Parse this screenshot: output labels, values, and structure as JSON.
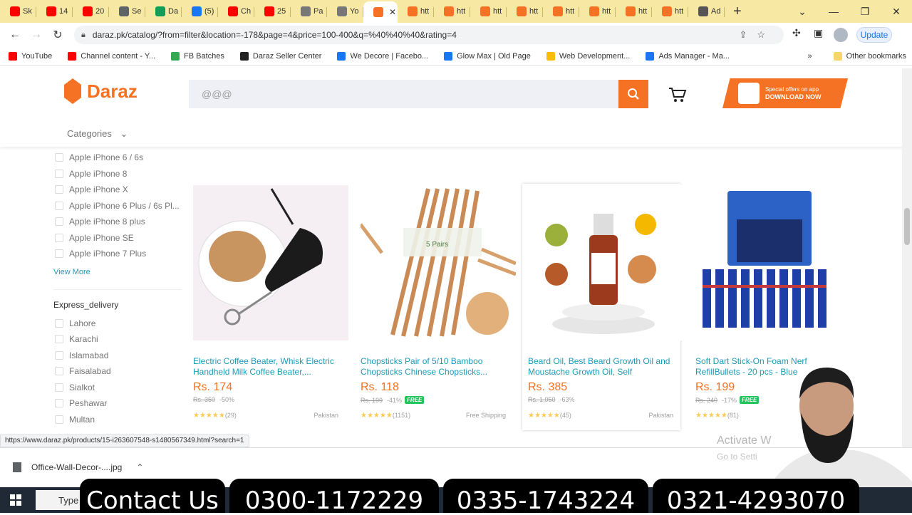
{
  "browser": {
    "tabs": [
      {
        "label": "Sk",
        "color": "#ff0000"
      },
      {
        "label": "14",
        "color": "#ff0000"
      },
      {
        "label": "20",
        "color": "#ff0000"
      },
      {
        "label": "Se",
        "color": "#5f6368"
      },
      {
        "label": "Da",
        "color": "#0f9d58"
      },
      {
        "label": "(5)",
        "color": "#1877f2"
      },
      {
        "label": "Ch",
        "color": "#ff0000"
      },
      {
        "label": "25",
        "color": "#ff0000"
      },
      {
        "label": "Pa",
        "color": "#777777"
      },
      {
        "label": "Yo",
        "color": "#777777"
      },
      {
        "label": "",
        "color": "#f57224"
      },
      {
        "label": "htt",
        "color": "#f57224"
      },
      {
        "label": "htt",
        "color": "#f57224"
      },
      {
        "label": "htt",
        "color": "#f57224"
      },
      {
        "label": "htt",
        "color": "#f57224"
      },
      {
        "label": "htt",
        "color": "#f57224"
      },
      {
        "label": "htt",
        "color": "#f57224"
      },
      {
        "label": "htt",
        "color": "#f57224"
      },
      {
        "label": "htt",
        "color": "#f57224"
      },
      {
        "label": "Ad",
        "color": "#555555"
      }
    ],
    "url": "daraz.pk/catalog/?from=filter&location=-178&page=4&price=100-400&q=%40%40%40&rating=4",
    "update_label": "Update",
    "bookmarks": [
      {
        "label": "YouTube",
        "color": "#ff0000"
      },
      {
        "label": "Channel content - Y...",
        "color": "#ff0000"
      },
      {
        "label": "FB Batches",
        "color": "#34a853"
      },
      {
        "label": "Daraz Seller Center",
        "color": "#222222"
      },
      {
        "label": "We Decore | Facebo...",
        "color": "#1877f2"
      },
      {
        "label": "Glow Max | Old Page",
        "color": "#1877f2"
      },
      {
        "label": "Web Development...",
        "color": "#fbbc04"
      },
      {
        "label": "Ads Manager - Ma...",
        "color": "#1877f2"
      }
    ],
    "other_bookmarks": "Other bookmarks",
    "status_url": "https://www.daraz.pk/products/15-i263607548-s1480567349.html?search=1"
  },
  "site": {
    "logo_text": "Daraz",
    "search_value": "@@@",
    "promo_line1": "Special offers on app",
    "promo_line2": "DOWNLOAD NOW",
    "categories_label": "Categories"
  },
  "filters": {
    "models": [
      "Apple iPhone 6 / 6s",
      "Apple iPhone 8",
      "Apple iPhone X",
      "Apple iPhone 6 Plus / 6s Pl...",
      "Apple iPhone 8 plus",
      "Apple iPhone SE",
      "Apple iPhone 7 Plus"
    ],
    "view_more": "View More",
    "express_heading": "Express_delivery",
    "cities": [
      "Lahore",
      "Karachi",
      "Islamabad",
      "Faisalabad",
      "Sialkot",
      "Peshawar",
      "Multan"
    ]
  },
  "products": [
    {
      "title": "Electric Coffee Beater, Whisk Electric Handheld Milk Coffee Beater,...",
      "price": "Rs. 174",
      "old": "Rs. 350",
      "discount": "-50%",
      "free": false,
      "reviews": "(29)",
      "location": "Pakistan"
    },
    {
      "title": "Chopsticks Pair of 5/10 Bamboo Chopsticks Chinese Chopsticks...",
      "price": "Rs. 118",
      "old": "Rs. 199",
      "discount": "-41%",
      "free": true,
      "free_label": "FREE",
      "reviews": "(1151)",
      "location": "Free Shipping"
    },
    {
      "title": "Beard Oil, Best Beard Growth Oil and Moustache Growth Oil, Self Groomin...",
      "price": "Rs. 385",
      "old": "Rs. 1,050",
      "discount": "-63%",
      "free": false,
      "reviews": "(45)",
      "location": "Pakistan"
    },
    {
      "title": "Soft Dart Stick-On Foam Nerf RefillBullets - 20 pcs - Blue",
      "price": "Rs. 199",
      "old": "Rs. 240",
      "discount": "-17%",
      "free": true,
      "free_label": "FREE",
      "reviews": "(81)",
      "location": ""
    }
  ],
  "downloads": {
    "file": "Office-Wall-Decor-....jpg"
  },
  "watermark": {
    "line1": "Activate W",
    "line2": "Go to Setti"
  },
  "taskbar": {
    "search": "Type"
  },
  "overlay": {
    "contact": "Contact Us",
    "phone1": "0300-1172229",
    "phone2": "0335-1743224",
    "phone3": "0321-4293070"
  }
}
